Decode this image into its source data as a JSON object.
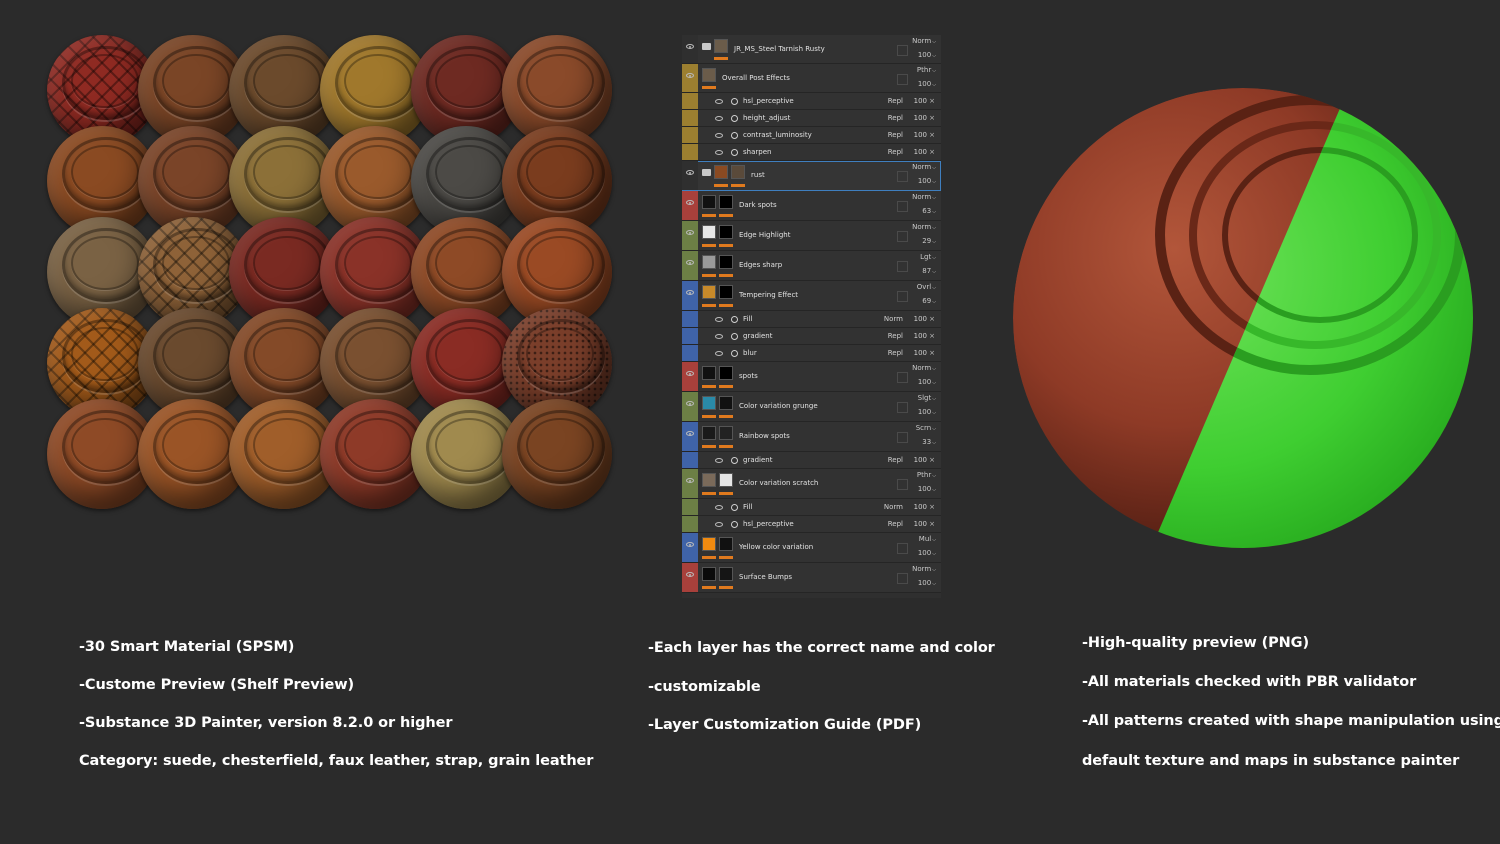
{
  "spheres": [
    {
      "color": "#8f2a22",
      "pattern": "quilt"
    },
    {
      "color": "#7a4526",
      "pattern": ""
    },
    {
      "color": "#6b4a2c",
      "pattern": ""
    },
    {
      "color": "#a0782c",
      "pattern": ""
    },
    {
      "color": "#6e2a22",
      "pattern": ""
    },
    {
      "color": "#8a4a2a",
      "pattern": ""
    },
    {
      "color": "#8a4a22",
      "pattern": ""
    },
    {
      "color": "#7a4428",
      "pattern": ""
    },
    {
      "color": "#8c7038",
      "pattern": ""
    },
    {
      "color": "#9a5a2c",
      "pattern": ""
    },
    {
      "color": "#4c4a46",
      "pattern": ""
    },
    {
      "color": "#7a3c1e",
      "pattern": ""
    },
    {
      "color": "#7a6244",
      "pattern": ""
    },
    {
      "color": "#8e6238",
      "pattern": "quilt"
    },
    {
      "color": "#7a2a22",
      "pattern": ""
    },
    {
      "color": "#8a3228",
      "pattern": ""
    },
    {
      "color": "#8e4a26",
      "pattern": ""
    },
    {
      "color": "#9a4a24",
      "pattern": ""
    },
    {
      "color": "#a25a1a",
      "pattern": "quilt"
    },
    {
      "color": "#6a4a2e",
      "pattern": ""
    },
    {
      "color": "#844a28",
      "pattern": ""
    },
    {
      "color": "#7a5030",
      "pattern": ""
    },
    {
      "color": "#8a2c24",
      "pattern": ""
    },
    {
      "color": "#7a3e2a",
      "pattern": "dots"
    },
    {
      "color": "#8e4a26",
      "pattern": ""
    },
    {
      "color": "#9a5426",
      "pattern": ""
    },
    {
      "color": "#a05e2a",
      "pattern": ""
    },
    {
      "color": "#8e3a28",
      "pattern": ""
    },
    {
      "color": "#a08a4e",
      "pattern": ""
    },
    {
      "color": "#7a4422",
      "pattern": ""
    }
  ],
  "layers": [
    {
      "type": "main",
      "name": "JR_MS_Steel Tarnish Rusty",
      "mode": "Norm",
      "opacity": "100",
      "strip": "#2f2f2f",
      "folder": true,
      "thumbs": [
        "#6b5c4a"
      ],
      "h": 29
    },
    {
      "type": "main",
      "name": "Overall Post Effects",
      "mode": "Pthr",
      "opacity": "100",
      "strip": "#9c7f30",
      "folder": false,
      "thumbs": [
        "#6b5c4a"
      ],
      "h": 29
    },
    {
      "type": "sub",
      "name": "hsl_perceptive",
      "mode": "Repl",
      "opacity": "100",
      "strip": "#9c7f30",
      "h": 17
    },
    {
      "type": "sub",
      "name": "height_adjust",
      "mode": "Repl",
      "opacity": "100",
      "strip": "#9c7f30",
      "h": 17
    },
    {
      "type": "sub",
      "name": "contrast_luminosity",
      "mode": "Repl",
      "opacity": "100",
      "strip": "#9c7f30",
      "h": 17
    },
    {
      "type": "sub",
      "name": "sharpen",
      "mode": "Repl",
      "opacity": "100",
      "strip": "#9c7f30",
      "h": 17
    },
    {
      "type": "main",
      "name": "rust",
      "mode": "Norm",
      "opacity": "100",
      "strip": "#2f2f2f",
      "folder": true,
      "thumbs": [
        "#8a4a22",
        "#5a4a3a"
      ],
      "h": 30,
      "selected": true
    },
    {
      "type": "main",
      "name": "Dark spots",
      "mode": "Norm",
      "opacity": "63",
      "strip": "#a8403b",
      "folder": false,
      "thumbs": [
        "#111111",
        "#000000"
      ],
      "h": 30
    },
    {
      "type": "main",
      "name": "Edge Highlight",
      "mode": "Norm",
      "opacity": "29",
      "strip": "#6c7f45",
      "folder": false,
      "thumbs": [
        "#e6e6e6",
        "#000000"
      ],
      "h": 30
    },
    {
      "type": "main",
      "name": "Edges sharp",
      "mode": "Lgt",
      "opacity": "87",
      "strip": "#6c7f45",
      "folder": false,
      "thumbs": [
        "#9a9a9a",
        "#000000"
      ],
      "h": 30
    },
    {
      "type": "main",
      "name": "Tempering Effect",
      "mode": "Ovrl",
      "opacity": "69",
      "strip": "#3f63a8",
      "folder": false,
      "thumbs": [
        "#c88a2a",
        "#000000"
      ],
      "h": 30
    },
    {
      "type": "sub",
      "name": "Fill",
      "mode": "Norm",
      "opacity": "100",
      "strip": "#3f63a8",
      "h": 17
    },
    {
      "type": "sub",
      "name": "gradient",
      "mode": "Repl",
      "opacity": "100",
      "strip": "#3f63a8",
      "h": 17
    },
    {
      "type": "sub",
      "name": "blur",
      "mode": "Repl",
      "opacity": "100",
      "strip": "#3f63a8",
      "h": 17
    },
    {
      "type": "main",
      "name": "spots",
      "mode": "Norm",
      "opacity": "100",
      "strip": "#a8403b",
      "folder": false,
      "thumbs": [
        "#111111",
        "#000000"
      ],
      "h": 30
    },
    {
      "type": "main",
      "name": "Color variation grunge",
      "mode": "Slgt",
      "opacity": "100",
      "strip": "#6c7f45",
      "folder": false,
      "thumbs": [
        "#2a8aa8",
        "#111111"
      ],
      "h": 30
    },
    {
      "type": "main",
      "name": "Rainbow spots",
      "mode": "Scrn",
      "opacity": "33",
      "strip": "#3f63a8",
      "folder": false,
      "thumbs": [
        "#1a1a1a",
        "#222222"
      ],
      "h": 30
    },
    {
      "type": "sub",
      "name": "gradient",
      "mode": "Repl",
      "opacity": "100",
      "strip": "#3f63a8",
      "h": 17
    },
    {
      "type": "main",
      "name": "Color variation scratch",
      "mode": "Pthr",
      "opacity": "100",
      "strip": "#6c7f45",
      "folder": false,
      "thumbs": [
        "#7a6a5a",
        "#e6e6e6"
      ],
      "h": 30
    },
    {
      "type": "sub",
      "name": "Fill",
      "mode": "Norm",
      "opacity": "100",
      "strip": "#6c7f45",
      "h": 17
    },
    {
      "type": "sub",
      "name": "hsl_perceptive",
      "mode": "Repl",
      "opacity": "100",
      "strip": "#6c7f45",
      "h": 17
    },
    {
      "type": "main",
      "name": "Yellow color variation",
      "mode": "Mul",
      "opacity": "100",
      "strip": "#3f63a8",
      "folder": false,
      "thumbs": [
        "#f08a10",
        "#111111"
      ],
      "h": 30
    },
    {
      "type": "main",
      "name": "Surface Bumps",
      "mode": "Norm",
      "opacity": "100",
      "strip": "#a8403b",
      "folder": false,
      "thumbs": [
        "#0a0a0a",
        "#151515"
      ],
      "h": 30
    }
  ],
  "text": {
    "col1": [
      "-30 Smart Material  (SPSM)",
      "-Custome Preview (Shelf Preview)",
      "-Substance 3D Painter, version 8.2.0 or higher",
      "Category: suede, chesterfield, faux leather, strap, grain leather"
    ],
    "col2": [
      "-Each layer has the correct name and color",
      "-customizable",
      "-Layer Customization Guide (PDF)"
    ],
    "col3": [
      "-High-quality preview (PNG)",
      "-All materials checked with PBR validator",
      "-All patterns created with shape manipulation using",
      "default texture and maps in substance painter"
    ]
  },
  "colors": {
    "leather": "#8e3a26",
    "green": "#3fce31",
    "accent": "#e07a1e",
    "selection": "#3f7fbf"
  }
}
